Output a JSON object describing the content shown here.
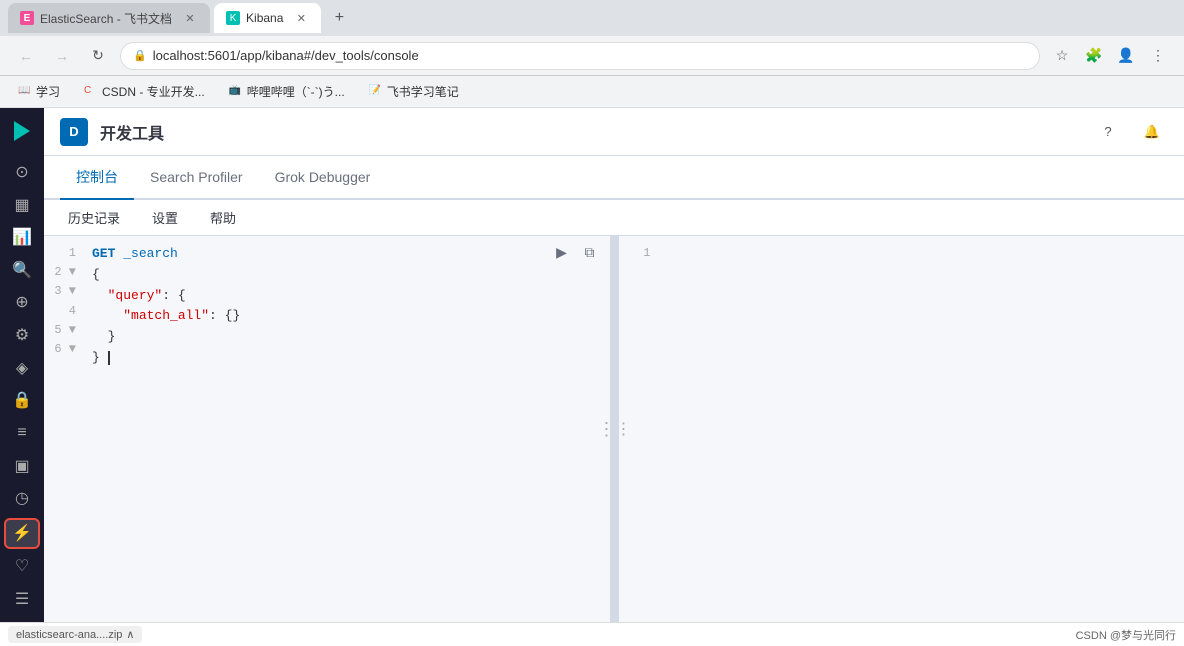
{
  "browser": {
    "tabs": [
      {
        "id": "elastic",
        "label": "ElasticSearch - 飞书文档",
        "favicon": "E",
        "active": false
      },
      {
        "id": "kibana",
        "label": "Kibana",
        "favicon": "K",
        "active": true
      }
    ],
    "url": "localhost:5601/app/kibana#/dev_tools/console",
    "bookmarks": [
      {
        "label": "学习"
      },
      {
        "label": "CSDN - 专业开发...",
        "color": "#e74c3c"
      },
      {
        "label": "哔哩哔哩（`-`)う..."
      },
      {
        "label": "飞书学习笔记"
      }
    ]
  },
  "app": {
    "logo_letter": "D",
    "title": "开发工具"
  },
  "tabs": [
    {
      "id": "console",
      "label": "控制台",
      "active": true
    },
    {
      "id": "search-profiler",
      "label": "Search Profiler",
      "active": false
    },
    {
      "id": "grok-debugger",
      "label": "Grok Debugger",
      "active": false
    }
  ],
  "toolbar": {
    "items": [
      "历史记录",
      "设置",
      "帮助"
    ]
  },
  "editor": {
    "lines": [
      {
        "num": "1",
        "tokens": [
          {
            "type": "method",
            "text": "GET"
          },
          {
            "type": "space",
            "text": " "
          },
          {
            "type": "url",
            "text": "_search"
          }
        ]
      },
      {
        "num": "2",
        "tokens": [
          {
            "type": "brace",
            "text": "{"
          }
        ]
      },
      {
        "num": "3",
        "tokens": [
          {
            "type": "space",
            "text": "  "
          },
          {
            "type": "key",
            "text": "\"query\""
          },
          {
            "type": "brace",
            "text": ": {"
          }
        ]
      },
      {
        "num": "4",
        "tokens": [
          {
            "type": "space",
            "text": "    "
          },
          {
            "type": "key",
            "text": "\"match_all\""
          },
          {
            "type": "brace",
            "text": ": {}"
          }
        ]
      },
      {
        "num": "5",
        "tokens": [
          {
            "type": "space",
            "text": "  "
          },
          {
            "type": "brace",
            "text": "}"
          }
        ]
      },
      {
        "num": "6",
        "tokens": [
          {
            "type": "brace",
            "text": "}"
          }
        ]
      }
    ]
  },
  "result": {
    "line_numbers": [
      "1"
    ]
  },
  "sidebar": {
    "icons": [
      {
        "id": "home",
        "symbol": "⊙",
        "active": false
      },
      {
        "id": "dashboard",
        "symbol": "▦",
        "active": false
      },
      {
        "id": "analytics",
        "symbol": "📊",
        "active": false
      },
      {
        "id": "discover",
        "symbol": "🔍",
        "active": false
      },
      {
        "id": "maps",
        "symbol": "⊕",
        "active": false
      },
      {
        "id": "ml",
        "symbol": "⚙",
        "active": false
      },
      {
        "id": "apm",
        "symbol": "◈",
        "active": false
      },
      {
        "id": "siem",
        "symbol": "🔒",
        "active": false
      },
      {
        "id": "logs",
        "symbol": "≡",
        "active": false
      },
      {
        "id": "infra",
        "symbol": "▣",
        "active": false
      },
      {
        "id": "uptime",
        "symbol": "◷",
        "active": false
      },
      {
        "id": "devtools",
        "symbol": "⚡",
        "highlighted": true
      },
      {
        "id": "stack",
        "symbol": "♡",
        "active": false
      },
      {
        "id": "management",
        "symbol": "☰",
        "active": false
      }
    ]
  },
  "download_bar": {
    "file": "elasticsearc-ana....zip",
    "chevron": "∧"
  },
  "bottom_right_text": "CSDN @梦与光同行",
  "drag_handle_text": "⋮"
}
